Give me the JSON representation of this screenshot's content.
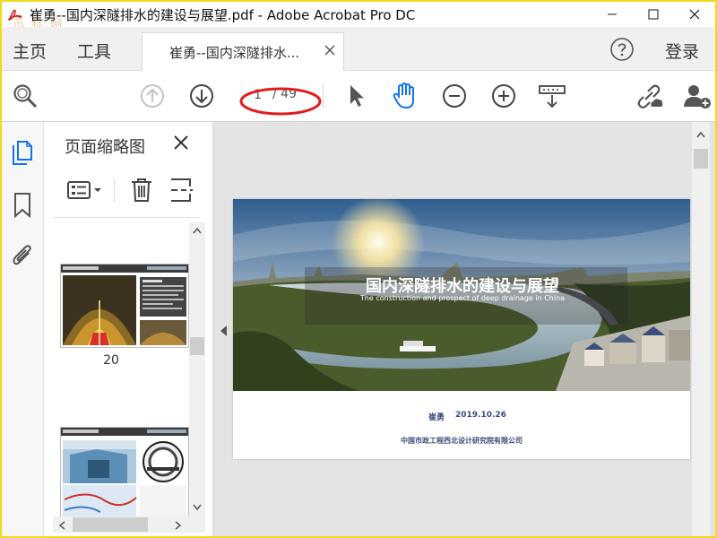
{
  "window": {
    "title": "崔勇--国内深隧排水的建设与展望.pdf - Adobe Acrobat Pro DC",
    "watermark": "迅 标 网"
  },
  "tabs": {
    "home": "主页",
    "tools": "工具",
    "document": "崔勇--国内深隧排水...",
    "login": "登录"
  },
  "toolbar": {
    "page_current": "1",
    "page_total": "/ 49",
    "icons": [
      "search-icon",
      "page-up-icon",
      "page-down-icon",
      "select-cursor-icon",
      "hand-tool-icon",
      "zoom-out-icon",
      "zoom-in-icon",
      "keyboard-scroll-icon",
      "share-link-icon",
      "add-user-icon"
    ]
  },
  "sidebar": {
    "icons": [
      "page-thumbnails-icon",
      "bookmarks-icon",
      "attachments-icon"
    ]
  },
  "thumbnail_panel": {
    "title": "页面缩略图",
    "pages": [
      {
        "label": "20"
      },
      {
        "label": ""
      }
    ]
  },
  "document_page": {
    "title_cn": "国内深隧排水的建设与展望",
    "title_en": "The construction and prospect of deep drainage in China",
    "author": "崔勇",
    "date": "2019.10.26",
    "organization": "中国市政工程西北设计研究院有限公司"
  },
  "colors": {
    "window_border": "#f3d91b",
    "icon_blue": "#1473e6",
    "annotation_red": "#e01e1e",
    "page_text": "#3b4c7a"
  }
}
